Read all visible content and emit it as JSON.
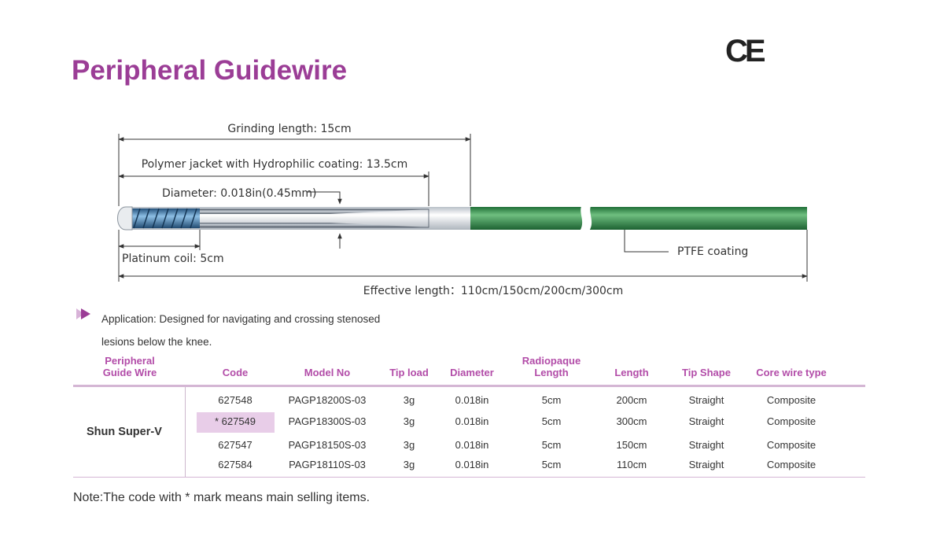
{
  "title": "Peripheral Guidewire",
  "ce_mark": "CE",
  "diagram": {
    "grinding_length": "Grinding length: 15cm",
    "polymer_jacket": "Polymer jacket with Hydrophilic coating: 13.5cm",
    "diameter": "Diameter: 0.018in(0.45mm)",
    "platinum_coil": "Platinum coil: 5cm",
    "ptfe": "PTFE coating",
    "effective_length": "Effective length：110cm/150cm/200cm/300cm",
    "colors": {
      "coil": "#3d7eb0",
      "jacket": "#dcdfe4",
      "ptfe": "#2f8a4a"
    }
  },
  "application": {
    "icon": "triangle-bullet-icon",
    "line1": "Application: Designed for navigating and crossing stenosed",
    "line2": "lesions below the knee."
  },
  "table": {
    "headers": {
      "product": [
        "Peripheral",
        "Guide Wire"
      ],
      "code": "Code",
      "model": "Model No",
      "tip_load": "Tip load",
      "diameter": "Diameter",
      "radiopaque": [
        "Radiopaque",
        "Length"
      ],
      "length": "Length",
      "tip_shape": "Tip Shape",
      "core": "Core wire type"
    },
    "product_name": "Shun Super-V",
    "rows": [
      {
        "code": "627548",
        "model": "PAGP18200S-03",
        "tip_load": "3g",
        "diameter": "0.018in",
        "radiopaque": "5cm",
        "length": "200cm",
        "tip_shape": "Straight",
        "core": "Composite"
      },
      {
        "code": "* 627549",
        "model": "PAGP18300S-03",
        "tip_load": "3g",
        "diameter": "0.018in",
        "radiopaque": "5cm",
        "length": "300cm",
        "tip_shape": "Straight",
        "core": "Composite"
      },
      {
        "code": "627547",
        "model": "PAGP18150S-03",
        "tip_load": "3g",
        "diameter": "0.018in",
        "radiopaque": "5cm",
        "length": "150cm",
        "tip_shape": "Straight",
        "core": "Composite"
      },
      {
        "code": "627584",
        "model": "PAGP18110S-03",
        "tip_load": "3g",
        "diameter": "0.018in",
        "radiopaque": "5cm",
        "length": "110cm",
        "tip_shape": "Straight",
        "core": "Composite"
      }
    ],
    "highlight_color": "#e8cde8",
    "header_color": "#b24ca8"
  },
  "note": "Note:The code with * mark means main selling items."
}
